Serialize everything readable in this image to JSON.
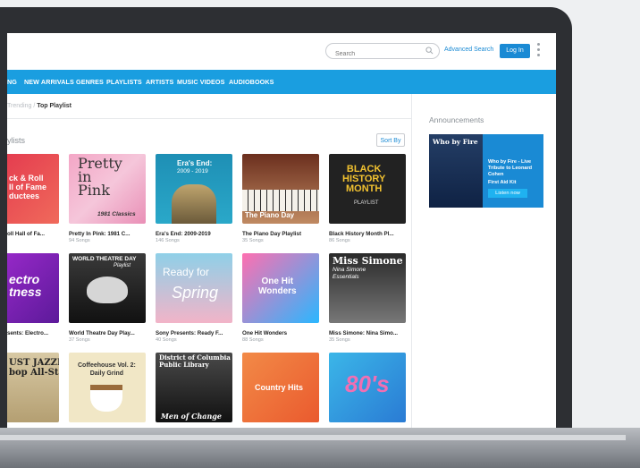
{
  "header": {
    "search_placeholder": "Search",
    "advanced_search": "Advanced Search",
    "login": "Log In"
  },
  "nav": [
    "NG",
    "NEW ARRIVALS",
    "GENRES",
    "PLAYLISTS",
    "ARTISTS",
    "MUSIC VIDEOS",
    "AUDIOBOOKS"
  ],
  "breadcrumb": {
    "prev": "Trending",
    "sep": "/",
    "current": "Top Playlist"
  },
  "section": {
    "title": "ylists",
    "sort": "Sort By"
  },
  "announcements": {
    "title": "Announcements",
    "art_title": "Who by Fire",
    "line1": "Who by Fire - Live Tribute to Leonard Cohen",
    "line2": "First Aid Kit",
    "button": "Listen now"
  },
  "tiles": [
    {
      "caption": "oll Hall of Fa...",
      "sub": "",
      "art": "ck & Roll\nll of Fame\nductees"
    },
    {
      "caption": "Pretty In Pink: 1981 C...",
      "sub": "94 Songs",
      "art": "Pretty\nin\nPink",
      "art2": "1981 Classics"
    },
    {
      "caption": "Era's End: 2009-2019",
      "sub": "146 Songs",
      "art": "Era's End:",
      "art2": "2009 - 2019"
    },
    {
      "caption": "The Piano Day Playlist",
      "sub": "35 Songs",
      "art": "The Piano Day",
      "art2": "Playlist"
    },
    {
      "caption": "Black History Month Pl...",
      "sub": "86 Songs",
      "art": "BLACK\nHISTORY\nMONTH",
      "art2": "PLAYLIST"
    },
    {
      "caption": "sents: Electro...",
      "sub": "",
      "art": "ectro\ntness"
    },
    {
      "caption": "World Theatre Day Play...",
      "sub": "37 Songs",
      "art": "WORLD THEATRE DAY",
      "art2": "Playlist"
    },
    {
      "caption": "Sony Presents: Ready F...",
      "sub": "40 Songs",
      "art": "Ready for",
      "art2": "Spring"
    },
    {
      "caption": "One Hit Wonders",
      "sub": "88 Songs",
      "art": "One Hit\nWonders"
    },
    {
      "caption": "Miss Simone: Nina Simo...",
      "sub": "35 Songs",
      "art": "Miss Simone",
      "art2": "Nina Simone\nEssentials"
    },
    {
      "caption": "",
      "sub": "",
      "art": "UST JAZZIN'\nbop All-Stars"
    },
    {
      "caption": "",
      "sub": "",
      "art": "Coffeehouse Vol. 2:\nDaily Grind"
    },
    {
      "caption": "",
      "sub": "",
      "art": "District of Columbia\nPublic Library",
      "art2": "Men of Change"
    },
    {
      "caption": "",
      "sub": "",
      "art": "Country Hits"
    },
    {
      "caption": "",
      "sub": "",
      "art": "80's"
    }
  ],
  "colors": {
    "accent": "#1a9ee0",
    "link": "#1a8ad4"
  }
}
